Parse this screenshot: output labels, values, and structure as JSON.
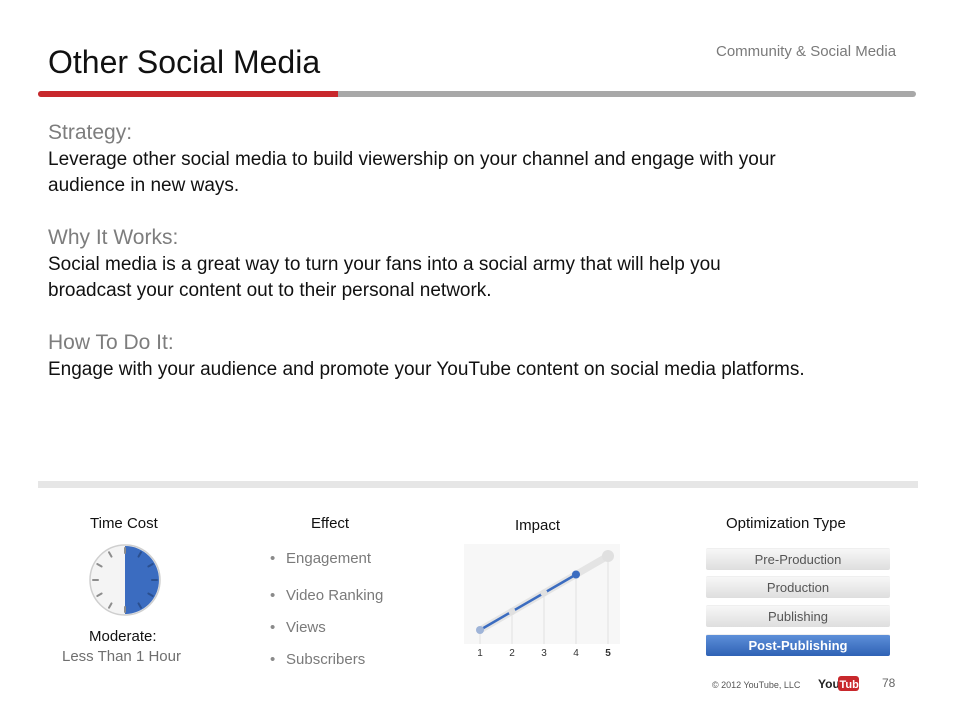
{
  "slide": {
    "title": "Other Social Media",
    "section": "Community & Social Media",
    "page_number": "78",
    "copyright": "© 2012 YouTube, LLC",
    "logo_text_you": "You",
    "logo_text_tube": "Tube"
  },
  "colors": {
    "accent_red": "#c8282c",
    "accent_blue": "#3b6cc0",
    "heading_grey": "#7d7d7d"
  },
  "strategy": {
    "heading": "Strategy:",
    "text": "Leverage other social media to build viewership on your channel and engage with your audience in new ways."
  },
  "why": {
    "heading": "Why It Works:",
    "text": "Social media is a great way to turn your fans into a social army that will help you broadcast your content out to their personal network."
  },
  "how": {
    "heading": "How To Do It:",
    "text": "Engage with your audience and promote your YouTube content on social media platforms."
  },
  "time_cost": {
    "label": "Time Cost",
    "level": "Moderate:",
    "detail": "Less Than 1 Hour",
    "clock_fill_fraction": 0.5,
    "icon": "clock-icon"
  },
  "effect": {
    "label": "Effect",
    "items": [
      "Engagement",
      "Video Ranking",
      "Views",
      "Subscribers"
    ]
  },
  "impact": {
    "label": "Impact",
    "icon": "impact-chart"
  },
  "chart_data": {
    "type": "line",
    "title": "Impact",
    "categories": [
      "1",
      "2",
      "3",
      "4",
      "5"
    ],
    "values": [
      1,
      2,
      3,
      4,
      5
    ],
    "highlighted_through": 4,
    "ylim": [
      0,
      5
    ]
  },
  "optimization": {
    "label": "Optimization Type",
    "options": [
      "Pre-Production",
      "Production",
      "Publishing",
      "Post-Publishing"
    ],
    "selected": "Post-Publishing"
  }
}
